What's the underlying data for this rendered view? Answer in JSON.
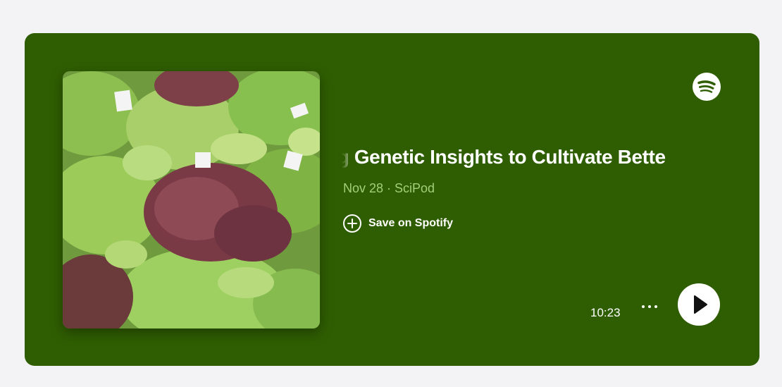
{
  "episode": {
    "title": "ng Genetic Insights to Cultivate Bette",
    "meta": "Nov 28 · SciPod",
    "save_label": "Save on Spotify",
    "duration": "10:23"
  },
  "colors": {
    "card_background": "#2f5e02",
    "meta_text": "#9fd07a",
    "page_background": "#f3f3f6"
  },
  "icons": {
    "brand": "spotify-icon",
    "save": "plus-circle-icon",
    "more": "more-dots-icon",
    "play": "play-icon"
  }
}
